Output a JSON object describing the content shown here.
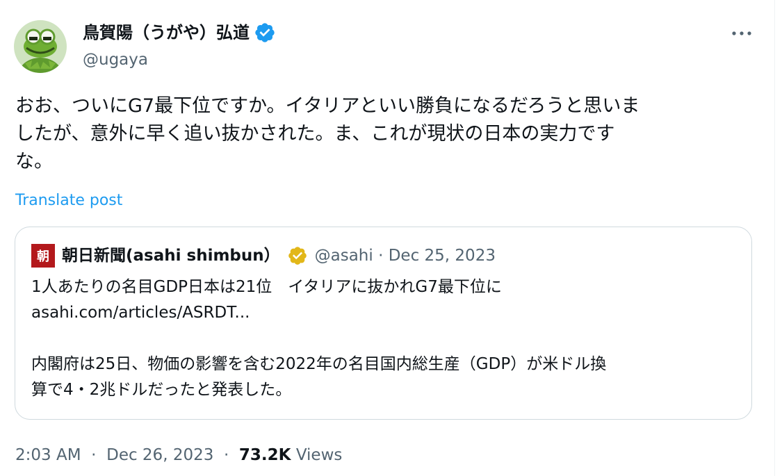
{
  "post": {
    "author_name": "鳥賀陽（うがや）弘道",
    "handle": "@ugaya",
    "text": "おお、ついにG7最下位ですか。イタリアといい勝負になるだろうと思いま\nしたが、意外に早く追い抜かされた。ま、これが現状の日本の実力です\nな。",
    "translate_label": "Translate post",
    "time": "2:03 AM",
    "date": "Dec 26, 2023",
    "separator": "·",
    "views_count": "73.2K",
    "views_label": "Views"
  },
  "quote": {
    "logo_text": "朝",
    "author_name": "朝日新聞(asahi shimbun）",
    "handle": "@asahi",
    "separator": "·",
    "date": "Dec 25, 2023",
    "text": "1人あたりの名目GDP日本は21位　イタリアに抜かれG7最下位に\nasahi.com/articles/ASRDT...\n\n内閣府は25日、物価の影響を含む2022年の名目国内総生産（GDP）が米ドル換\n算で4・2兆ドルだったと発表した。"
  },
  "icons": {
    "avatar": "frog-avatar",
    "verified": "blue-verified-badge",
    "quote_verified": "gold-verified-badge",
    "more": "more-options-icon"
  },
  "colors": {
    "link": "#1d9bf0",
    "secondary_text": "#536471",
    "verified_blue": "#1d9bf0",
    "verified_gold": "#e2b719",
    "asahi_red": "#b3191c"
  }
}
